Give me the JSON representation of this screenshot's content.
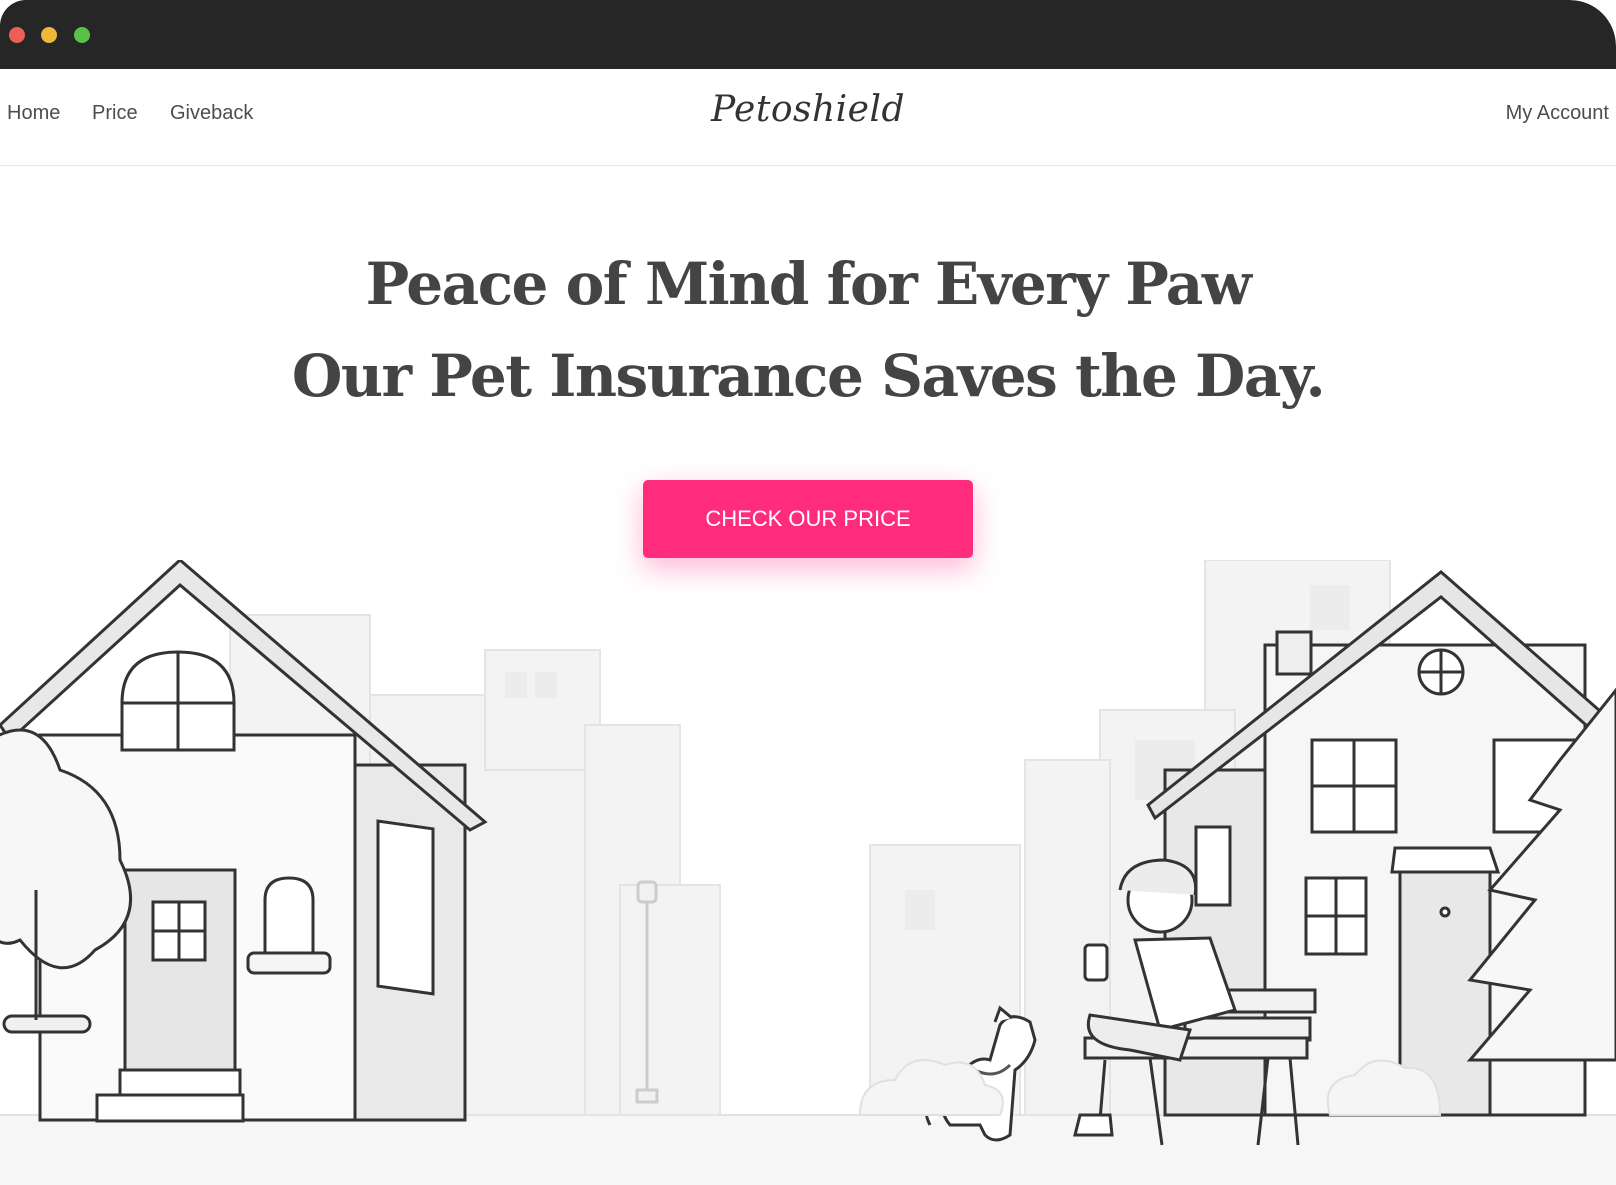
{
  "window": {
    "controls": [
      "close",
      "minimize",
      "maximize"
    ]
  },
  "nav": {
    "links": [
      "Home",
      "Price",
      "Giveback"
    ],
    "logo": "Petoshield",
    "account": "My Account"
  },
  "hero": {
    "title_line1": "Peace of Mind for Every Paw",
    "title_line2": "Our Pet Insurance Saves the Day.",
    "cta_label": "CHECK OUR PRICE"
  },
  "illustration": {
    "subject": "neighborhood-street-with-person-and-dog",
    "icons": [
      "house-left-icon",
      "house-right-icon",
      "city-buildings-icon",
      "tree-icon",
      "pine-tree-icon",
      "street-lamp-icon",
      "bench-icon",
      "person-with-phone-icon",
      "dog-icon"
    ]
  },
  "colors": {
    "accent": "#ff2b7d",
    "titlebar": "#262626",
    "text": "#444444",
    "nav_text": "#4d4d4d",
    "line_art": "#333333"
  }
}
